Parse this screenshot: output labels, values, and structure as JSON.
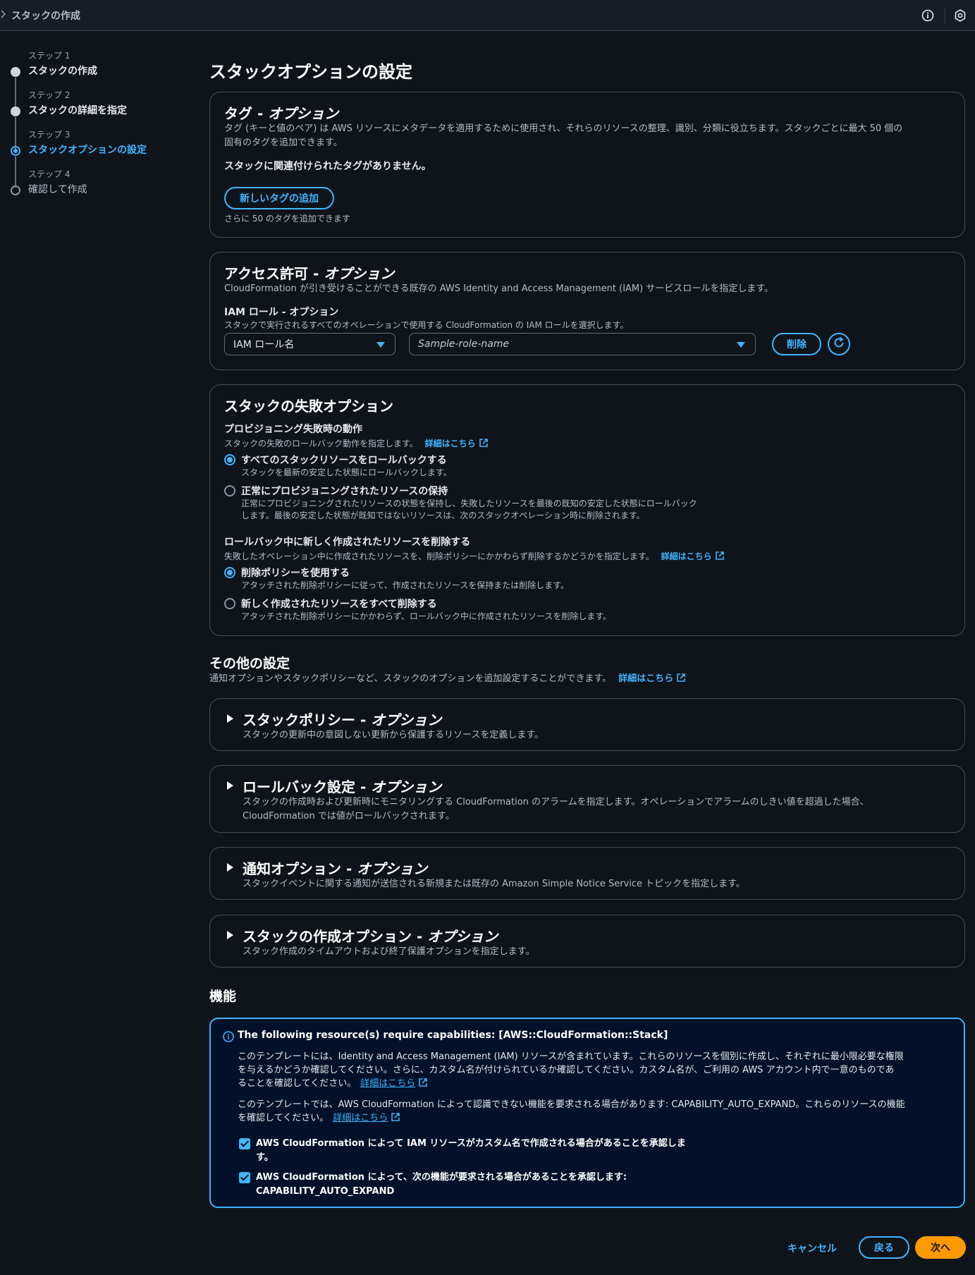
{
  "topbar": {
    "breadcrumb": "スタックの作成"
  },
  "stepper": {
    "steps": [
      {
        "num": "ステップ 1",
        "label": "スタックの作成"
      },
      {
        "num": "ステップ 2",
        "label": "スタックの詳細を指定"
      },
      {
        "num": "ステップ 3",
        "label": "スタックオプションの設定"
      },
      {
        "num": "ステップ 4",
        "label": "確認して作成"
      }
    ]
  },
  "page": {
    "title": "スタックオプションの設定"
  },
  "tags": {
    "title_main": "タグ - ",
    "title_opt": "オプション",
    "desc_line1": "タグ (キーと値のペア) は AWS リソースにメタデータを適用するために使用され、それらのリソースの整理、識別、分類に役立ちます。スタックごとに最大 50 個の",
    "desc_line2": "固有のタグを追加できます。",
    "empty": "スタックに関連付けられたタグがありません。",
    "add_button": "新しいタグの追加",
    "remaining": "さらに 50 のタグを追加できます"
  },
  "access": {
    "title_main": "アクセス許可 - ",
    "title_opt": "オプション",
    "desc": "CloudFormation が引き受けることができる既存の AWS Identity and Access Management (IAM) サービスロールを指定します。",
    "role_label": "IAM ロール - オプション",
    "role_desc": "スタックで実行されるすべてのオペレーションで使用する CloudFormation の IAM ロールを選択します。",
    "role_type": "IAM ロール名",
    "role_placeholder": "Sample-role-name",
    "delete_button": "削除"
  },
  "failure": {
    "title": "スタックの失敗オプション",
    "prov_label": "プロビジョニング失敗時の動作",
    "prov_desc": "スタックの失敗のロールバック動作を指定します。",
    "learn_more": "詳細はこちら",
    "opt1_label": "すべてのスタックリソースをロールバックする",
    "opt1_desc": "スタックを最新の安定した状態にロールバックします。",
    "opt2_label": "正常にプロビジョニングされたリソースの保持",
    "opt2_desc1": "正常にプロビジョニングされたリソースの状態を保持し、失敗したリソースを最後の既知の安定した状態にロールバック",
    "opt2_desc2": "します。最後の安定した状態が既知ではないリソースは、次のスタックオペレーション時に削除されます。",
    "del_label": "ロールバック中に新しく作成されたリソースを削除する",
    "del_desc": "失敗したオペレーション中に作成されたリソースを、削除ポリシーにかかわらず削除するかどうかを指定します。",
    "opt3_label": "削除ポリシーを使用する",
    "opt3_desc": "アタッチされた削除ポリシーに従って、作成されたリソースを保持または削除します。",
    "opt4_label": "新しく作成されたリソースをすべて削除する",
    "opt4_desc": "アタッチされた削除ポリシーにかかわらず、ロールバック中に作成されたリソースを削除します。"
  },
  "other": {
    "title": "その他の設定",
    "desc": "通知オプションやスタックポリシーなど、スタックのオプションを追加設定することができます。",
    "learn_more": "詳細はこちら",
    "sections": [
      {
        "title": "スタックポリシー - ",
        "opt": "オプション",
        "desc1": "スタックの更新中の意図しない更新から保護するリソースを定義します。",
        "desc2": ""
      },
      {
        "title": "ロールバック設定 - ",
        "opt": "オプション",
        "desc1": "スタックの作成時および更新時にモニタリングする CloudFormation のアラームを指定します。オペレーションでアラームのしきい値を超過した場合、",
        "desc2": "CloudFormation では値がロールバックされます。"
      },
      {
        "title": "通知オプション - ",
        "opt": "オプション",
        "desc1": "スタックイベントに関する通知が送信される新規または既存の Amazon Simple Notice Service トピックを指定します。",
        "desc2": ""
      },
      {
        "title": "スタックの作成オプション - ",
        "opt": "オプション",
        "desc1": "スタック作成のタイムアウトおよび終了保護オプションを指定します。",
        "desc2": ""
      }
    ]
  },
  "capabilities": {
    "title": "機能",
    "alert_title": "The following resource(s) require capabilities: [AWS::CloudFormation::Stack]",
    "p1_l1": "このテンプレートには、Identity and Access Management (IAM) リソースが含まれています。これらのリソースを個別に作成し、それぞれに最小限必要な権限",
    "p1_l2": "を与えるかどうか確認してください。さらに、カスタム名が付けられているか確認してください。カスタム名が、ご利用の AWS アカウント内で一意のものであ",
    "p1_l3": "ることを確認してください。",
    "p2_l1": "このテンプレートでは、AWS CloudFormation によって認識できない機能を要求される場合があります: CAPABILITY_AUTO_EXPAND。これらのリソースの機能",
    "p2_l2": "を確認してください。",
    "learn_more": "詳細はこちら",
    "ack1_l1": "AWS CloudFormation によって IAM リソースがカスタム名で作成される場合があることを承認しま",
    "ack1_l2": "す。",
    "ack2_l1": "AWS CloudFormation によって、次の機能が要求される場合があることを承認します:",
    "ack2_l2": "CAPABILITY_AUTO_EXPAND"
  },
  "footer": {
    "cancel": "キャンセル",
    "back": "戻る",
    "next": "次へ"
  },
  "colors": {
    "accent": "#42b4ff",
    "primary": "#ff9900",
    "background": "#0f141a"
  }
}
